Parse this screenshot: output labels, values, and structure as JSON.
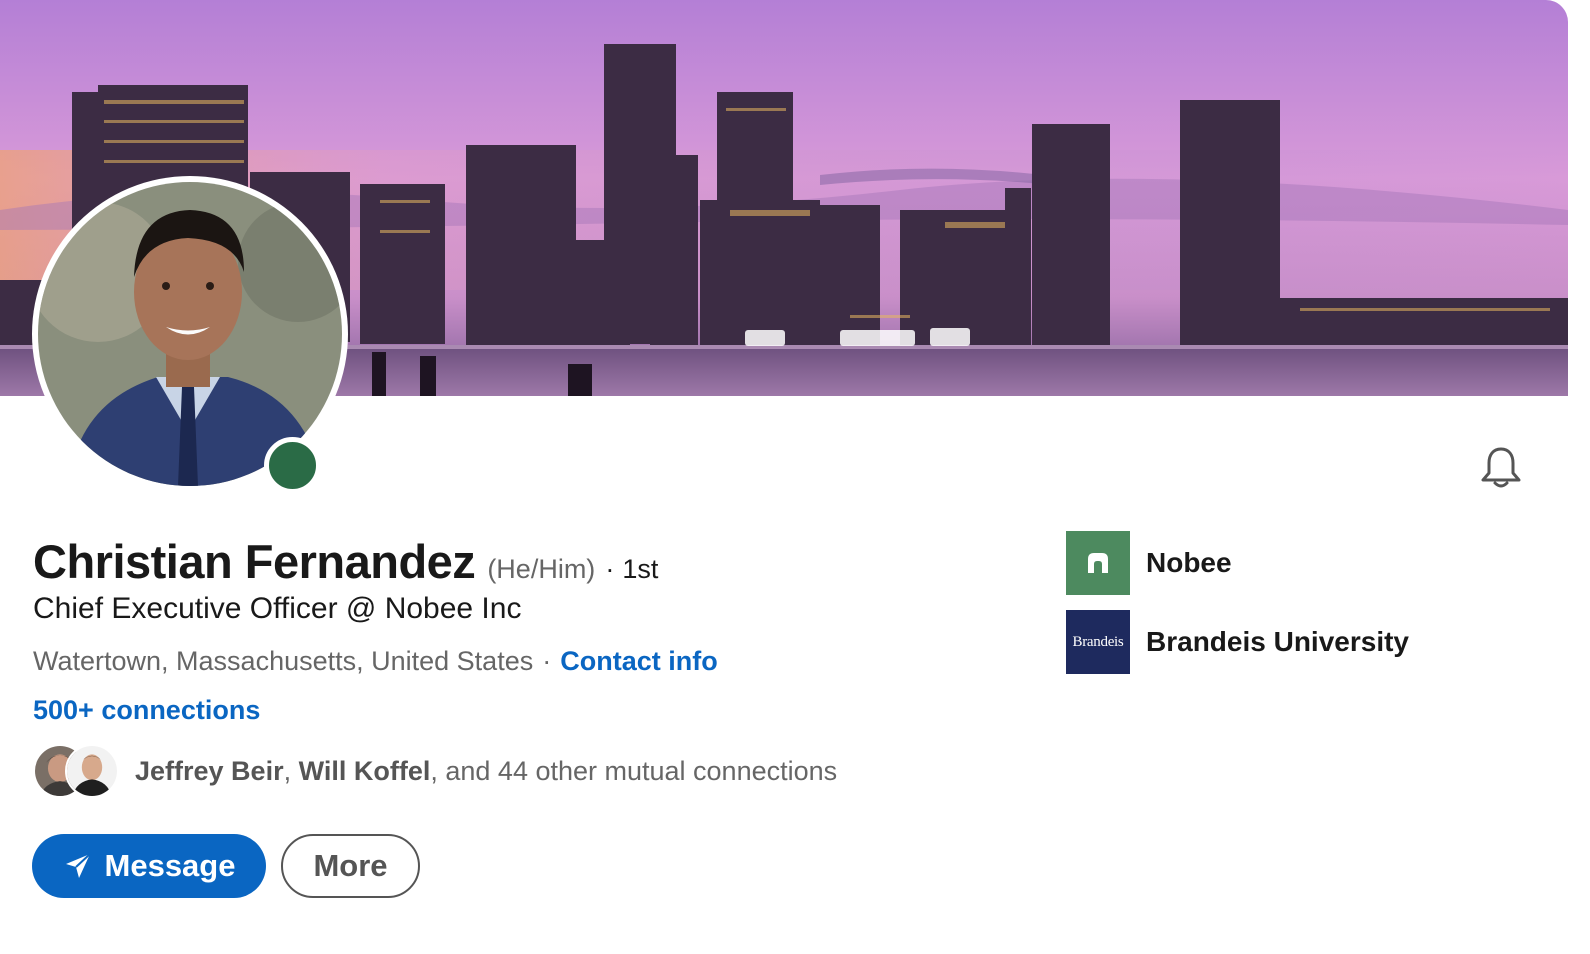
{
  "profile": {
    "name": "Christian Fernandez",
    "pronouns": "(He/Him)",
    "degree_separator": "·",
    "degree": "1st",
    "headline": "Chief Executive Officer @ Nobee Inc",
    "location": "Watertown, Massachusetts, United States",
    "location_separator": "·",
    "contact_info_label": "Contact info",
    "connections_label": "500+ connections",
    "presence_status": "online",
    "presence_color": "#2a6b46"
  },
  "mutual": {
    "person1": "Jeffrey Beir",
    "comma": ",",
    "person2": "Will Koffel",
    "rest": ", and 44 other mutual connections"
  },
  "actions": {
    "message_label": "Message",
    "more_label": "More",
    "notification_icon": "bell-icon"
  },
  "organizations": [
    {
      "name": "Nobee",
      "logo_text": "",
      "logo_color": "#4d8a5f"
    },
    {
      "name": "Brandeis University",
      "logo_text": "Brandeis",
      "logo_color": "#1e2a5e"
    }
  ],
  "colors": {
    "accent": "#0a66c2",
    "text_primary": "#191919",
    "text_secondary": "#666666"
  }
}
